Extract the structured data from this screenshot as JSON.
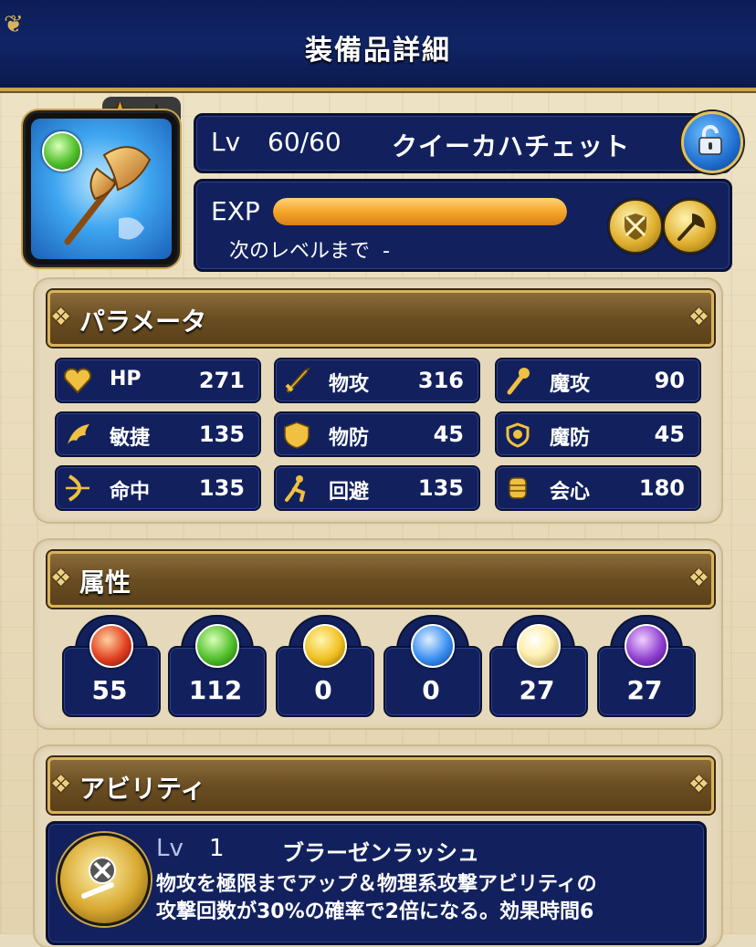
{
  "header": {
    "title": "装備品詳細"
  },
  "item": {
    "element_icon": "wind-orb-icon",
    "stars_filled": 1,
    "stars_total": 2,
    "level_label": "Lv",
    "level_value": "60/60",
    "name": "クイーカハチェット",
    "locked": false
  },
  "exp": {
    "label": "EXP",
    "progress": 1.0,
    "next_label": "次のレベルまで",
    "next_value": "-",
    "type_icons": [
      "shield-axe-icon",
      "axe-icon"
    ]
  },
  "parameters": {
    "title": "パラメータ",
    "stats": [
      {
        "label": "HP",
        "value": "271",
        "icon": "heart-icon",
        "color": "#f0c040"
      },
      {
        "label": "物攻",
        "value": "316",
        "icon": "sword-icon",
        "color": "#f0c040"
      },
      {
        "label": "魔攻",
        "value": "90",
        "icon": "wand-icon",
        "color": "#f0c040"
      },
      {
        "label": "敏捷",
        "value": "135",
        "icon": "wing-icon",
        "color": "#f0c040"
      },
      {
        "label": "物防",
        "value": "45",
        "icon": "shield-icon",
        "color": "#f0c040"
      },
      {
        "label": "魔防",
        "value": "45",
        "icon": "magic-shield-icon",
        "color": "#f0c040"
      },
      {
        "label": "命中",
        "value": "135",
        "icon": "bow-icon",
        "color": "#f0c040"
      },
      {
        "label": "回避",
        "value": "135",
        "icon": "dodge-icon",
        "color": "#f0c040"
      },
      {
        "label": "会心",
        "value": "180",
        "icon": "fist-icon",
        "color": "#f0c040"
      }
    ]
  },
  "attributes": {
    "title": "属性",
    "elements": [
      {
        "name": "fire-orb-icon",
        "value": "55",
        "color": "#e04020"
      },
      {
        "name": "wind-orb-icon",
        "value": "112",
        "color": "#4fbf2a"
      },
      {
        "name": "thunder-orb-icon",
        "value": "0",
        "color": "#f0c020"
      },
      {
        "name": "ice-orb-icon",
        "value": "0",
        "color": "#3a8ff0"
      },
      {
        "name": "light-orb-icon",
        "value": "27",
        "color": "#fff0b0"
      },
      {
        "name": "dark-orb-icon",
        "value": "27",
        "color": "#9040d0"
      }
    ]
  },
  "ability": {
    "title": "アビリティ",
    "level_label": "Lv",
    "level_value": "1",
    "name": "ブラーゼンラッシュ",
    "description_line1": "物攻を極限までアップ＆物理系攻撃アビリティの",
    "description_line2": "攻撃回数が30%の確率で2倍になる。効果時間6"
  }
}
